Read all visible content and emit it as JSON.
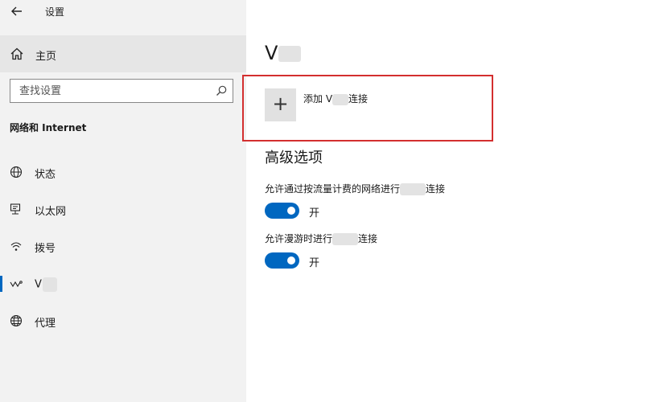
{
  "window": {
    "title": "设置",
    "back_icon": "back-arrow-icon"
  },
  "sidebar": {
    "home_label": "主页",
    "search_placeholder": "查找设置",
    "section_heading": "网络和 Internet",
    "items": [
      {
        "label": "状态",
        "icon": "globe-status-icon",
        "selected": false
      },
      {
        "label": "以太网",
        "icon": "ethernet-icon",
        "selected": false
      },
      {
        "label": "拨号",
        "icon": "dialup-icon",
        "selected": false
      },
      {
        "label": "V",
        "icon": "vpn-icon",
        "selected": true
      },
      {
        "label": "代理",
        "icon": "globe-icon",
        "selected": false
      }
    ]
  },
  "main": {
    "heading": "V",
    "add_connection": {
      "label_prefix": "添加 V",
      "label_suffix": "连接"
    },
    "advanced_heading": "高级选项",
    "settings": [
      {
        "label_prefix": "允许通过按流量计费的网络进行",
        "label_suffix": "连接",
        "state_text": "开"
      },
      {
        "label_prefix": "允许漫游时进行",
        "label_suffix": "连接",
        "state_text": "开"
      }
    ]
  },
  "colors": {
    "accent": "#0067c0",
    "highlight_border": "#d32f2f",
    "sidebar_bg": "#f2f2f2"
  }
}
